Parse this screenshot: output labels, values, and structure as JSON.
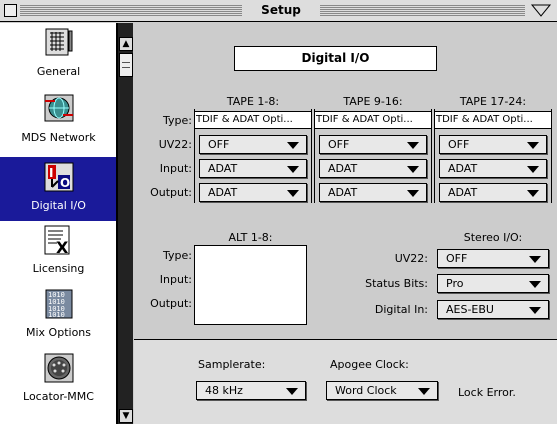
{
  "window": {
    "title": "Setup"
  },
  "sidebar": {
    "items": [
      {
        "label": "General",
        "icon": "general-grid-icon",
        "selected": false
      },
      {
        "label": "MDS Network",
        "icon": "network-globe-icon",
        "selected": false
      },
      {
        "label": "Digital I/O",
        "icon": "digital-io-icon",
        "selected": true
      },
      {
        "label": "Licensing",
        "icon": "licensing-x-icon",
        "selected": false
      },
      {
        "label": "Mix Options",
        "icon": "mix-binary-icon",
        "selected": false
      },
      {
        "label": "Locator-MMC",
        "icon": "locator-connector-icon",
        "selected": false
      }
    ]
  },
  "panel": {
    "title": "Digital I/O"
  },
  "row_labels": {
    "type": "Type:",
    "uv22": "UV22:",
    "input": "Input:",
    "output": "Output:"
  },
  "tapes": [
    {
      "header": "TAPE 1-8:",
      "type": "TDIF & ADAT Opti...",
      "uv22": "OFF",
      "input": "ADAT",
      "output": "ADAT"
    },
    {
      "header": "TAPE 9-16:",
      "type": "TDIF & ADAT Opti...",
      "uv22": "OFF",
      "input": "ADAT",
      "output": "ADAT"
    },
    {
      "header": "TAPE 17-24:",
      "type": "TDIF & ADAT Opti...",
      "uv22": "OFF",
      "input": "ADAT",
      "output": "ADAT"
    }
  ],
  "alt": {
    "header": "ALT 1-8:"
  },
  "stereo": {
    "header": "Stereo I/O:",
    "uv22_label": "UV22:",
    "uv22": "OFF",
    "status_bits_label": "Status Bits:",
    "status_bits": "Pro",
    "digital_in_label": "Digital In:",
    "digital_in": "AES-EBU"
  },
  "clock": {
    "samplerate_label": "Samplerate:",
    "samplerate": "48 kHz",
    "apogee_label": "Apogee Clock:",
    "apogee": "Word Clock",
    "lock_status": "Lock Error."
  }
}
